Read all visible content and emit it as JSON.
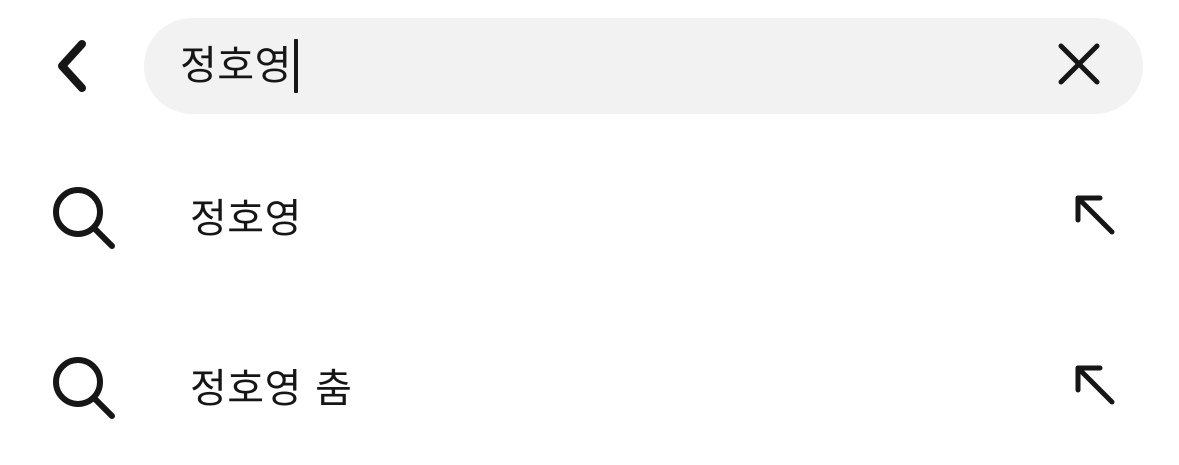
{
  "search": {
    "value": "정호영",
    "icons": {
      "back": "chevron-left-icon",
      "clear": "close-icon"
    }
  },
  "suggestions": [
    {
      "label": "정호영",
      "icon": "search-icon",
      "action_icon": "arrow-up-left-icon"
    },
    {
      "label": "정호영 춤",
      "icon": "search-icon",
      "action_icon": "arrow-up-left-icon"
    }
  ],
  "colors": {
    "background": "#ffffff",
    "search_bar": "#f2f2f2",
    "text": "#161616"
  }
}
